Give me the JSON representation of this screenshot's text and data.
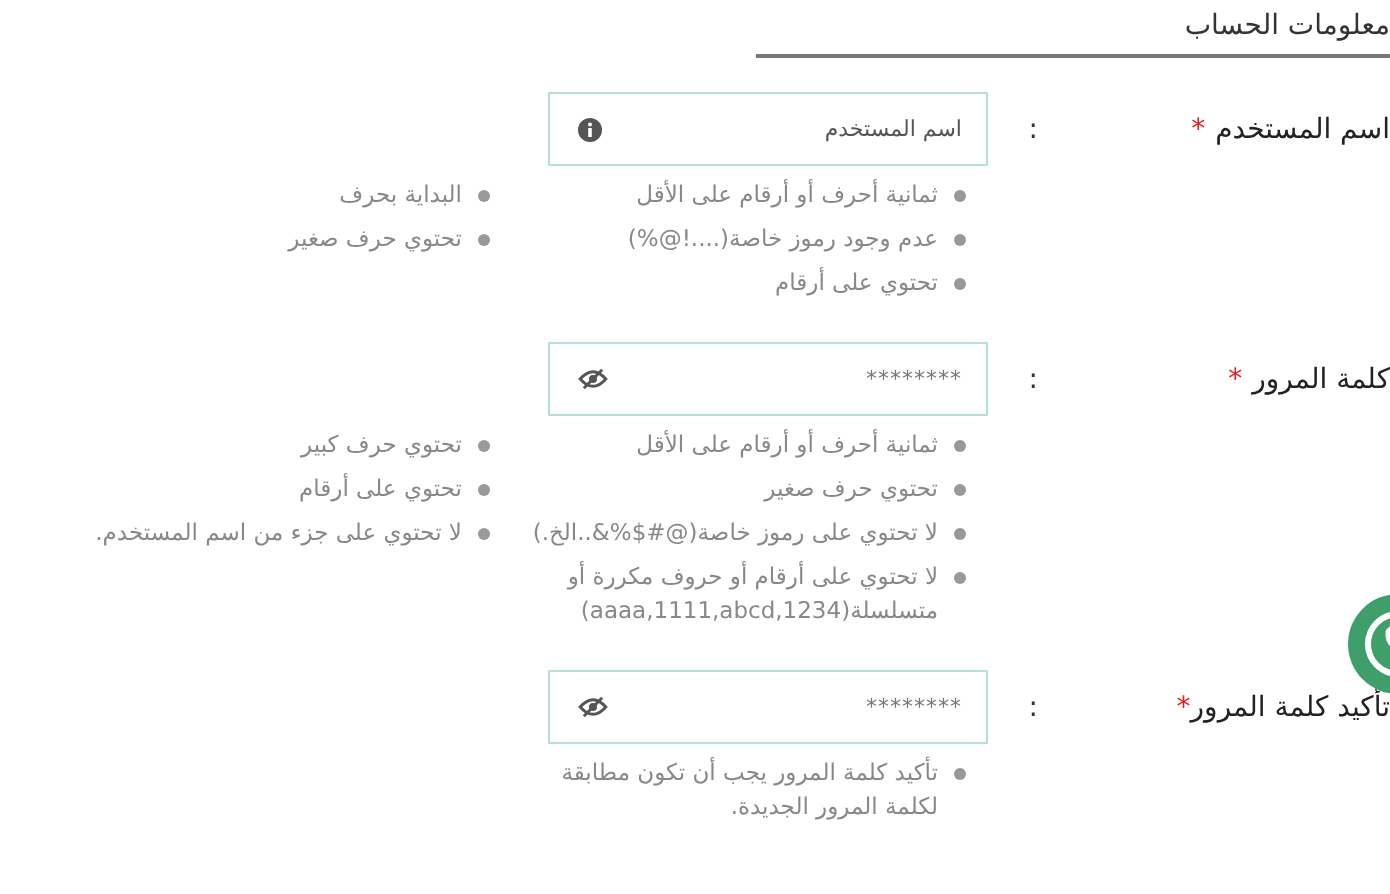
{
  "section_title": "معلومات الحساب",
  "fields": [
    {
      "kind": "text",
      "label": "اسم المستخدم",
      "required_mark": "*",
      "colon": ":",
      "placeholder": "اسم المستخدم",
      "hint_columns": [
        [
          "ثمانية أحرف أو أرقام على الأقل",
          "عدم وجود رموز خاصة(....!@%)",
          "تحتوي على أرقام"
        ],
        [
          "البداية بحرف",
          "تحتوي حرف صغير"
        ]
      ]
    },
    {
      "kind": "password",
      "label": "كلمة المرور",
      "required_mark": "*",
      "colon": ":",
      "value": "********",
      "hint_columns": [
        [
          "ثمانية أحرف أو أرقام على الأقل",
          "تحتوي حرف صغير",
          "لا تحتوي على رموز خاصة(@#$%&..الخ.)",
          "لا تحتوي على أرقام أو حروف مكررة أو متسلسلة(aaaa,1111,abcd,1234)"
        ],
        [
          "تحتوي حرف كبير",
          "تحتوي على أرقام",
          "لا تحتوي على جزء من اسم المستخدم."
        ]
      ]
    },
    {
      "kind": "password",
      "label": "تأكيد كلمة المرور",
      "required_mark": "*",
      "colon": ":",
      "value": "********",
      "hint_columns": [
        [
          "تأكيد كلمة المرور يجب أن تكون مطابقة لكلمة المرور الجديدة."
        ]
      ]
    }
  ]
}
